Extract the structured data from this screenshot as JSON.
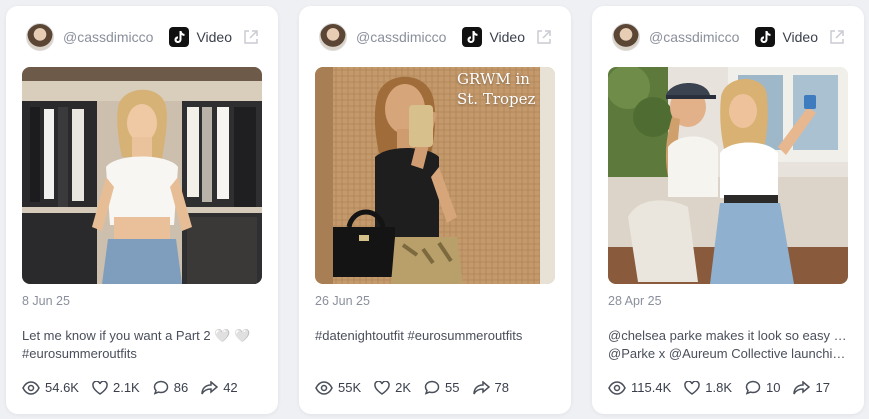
{
  "colors": {
    "background": "#eef0f4",
    "card": "#ffffff",
    "muted_text": "#8a8f9b",
    "text": "#3a3f4b"
  },
  "cards": [
    {
      "handle": "@cassdimicco",
      "platform_label": "Video",
      "platform_icon": "tiktok-icon",
      "overlay_text": "",
      "date": "8 Jun 25",
      "caption_lines": [
        "Let me know if you want a Part 2 🤍 🤍",
        "#eurosummeroutfits"
      ],
      "stats": {
        "views": "54.6K",
        "likes": "2.1K",
        "comments": "86",
        "shares": "42"
      }
    },
    {
      "handle": "@cassdimicco",
      "platform_label": "Video",
      "platform_icon": "tiktok-icon",
      "overlay_text": "GRWM in St. Tropez",
      "date": "26 Jun 25",
      "caption_lines": [
        "",
        "#datenightoutfit #eurosummeroutfits"
      ],
      "stats": {
        "views": "55K",
        "likes": "2K",
        "comments": "55",
        "shares": "78"
      }
    },
    {
      "handle": "@cassdimicco",
      "platform_label": "Video",
      "platform_icon": "tiktok-icon",
      "overlay_text": "",
      "date": "28 Apr 25",
      "caption_lines": [
        "@chelsea parke makes it look so easy 😂",
        "@Parke x @Aureum Collective launchin..."
      ],
      "stats": {
        "views": "115.4K",
        "likes": "1.8K",
        "comments": "10",
        "shares": "17"
      }
    }
  ]
}
